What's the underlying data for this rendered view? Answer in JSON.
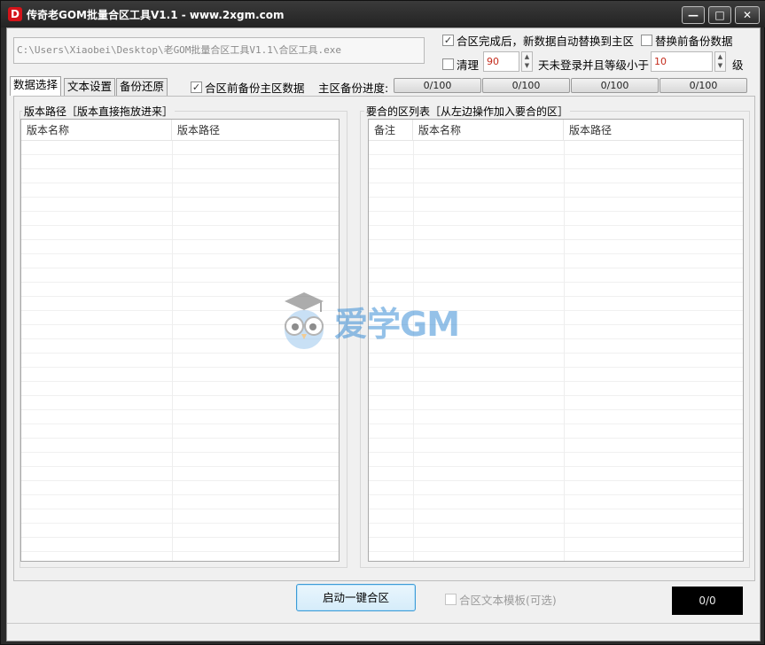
{
  "window": {
    "title": "传奇老GOM批量合区工具V1.1 - www.2xgm.com",
    "icon_letter": "D",
    "controls": {
      "minimize": "—",
      "maximize": "□",
      "close": "✕"
    }
  },
  "toolbar": {
    "exe_path": "C:\\Users\\Xiaobei\\Desktop\\老GOM批量合区工具V1.1\\合区工具.exe",
    "auto_replace": {
      "label": "合区完成后，新数据自动替换到主区",
      "checked": true
    },
    "backup_before_replace": {
      "label": "替换前备份数据",
      "checked": false
    },
    "clean": {
      "label": "清理",
      "checked": false
    },
    "days_value": "90",
    "days_label": "天未登录并且等级小于",
    "level_value": "10",
    "level_label": "级"
  },
  "tabs": [
    {
      "label": "数据选择",
      "active": true
    },
    {
      "label": "文本设置",
      "active": false
    },
    {
      "label": "备份还原",
      "active": false
    }
  ],
  "backup_main_before_merge": {
    "label": "合区前备份主区数据",
    "checked": true
  },
  "backup_progress": {
    "label": "主区备份进度:",
    "bars": [
      "0/100",
      "0/100",
      "0/100",
      "0/100"
    ]
  },
  "left_group": {
    "title": "版本路径［版本直接拖放进来］",
    "columns": [
      "版本名称",
      "版本路径"
    ]
  },
  "right_group": {
    "title": "要合的区列表［从左边操作加入要合的区］",
    "columns": [
      "备注",
      "版本名称",
      "版本路径"
    ]
  },
  "watermark": {
    "text": "爱学GM"
  },
  "footer": {
    "start_button": "启动一键合区",
    "template_option": {
      "label": "合区文本模板(可选)",
      "checked": false,
      "disabled": true
    },
    "counter": "0/0"
  }
}
